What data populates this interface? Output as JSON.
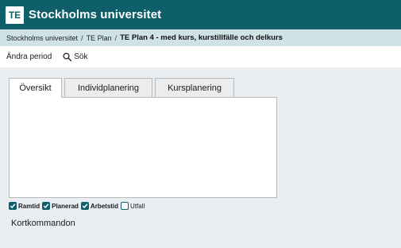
{
  "header": {
    "logo_text": "TE",
    "app_title": "Stockholms universitet",
    "color": "#0e5f69"
  },
  "breadcrumb": {
    "items": [
      "Stockholms universitet",
      "TE Plan"
    ],
    "separator": "/",
    "current": "TE Plan 4 - med kurs, kurstillfälle och delkurs"
  },
  "toolbar": {
    "change_period_label": "Ändra period",
    "search_label": "Sök",
    "search_icon": "search-icon"
  },
  "tabs": [
    {
      "label": "Översikt",
      "active": true
    },
    {
      "label": "Individplanering",
      "active": false
    },
    {
      "label": "Kursplanering",
      "active": false
    }
  ],
  "legend": [
    {
      "label": "Ramtid",
      "checked": true
    },
    {
      "label": "Planerad",
      "checked": true
    },
    {
      "label": "Arbetstid",
      "checked": true
    },
    {
      "label": "Utfall",
      "checked": false
    }
  ],
  "shortcuts_label": "Kortkommandon"
}
